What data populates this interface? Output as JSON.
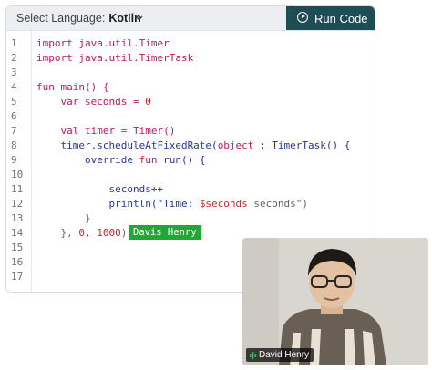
{
  "toolbar": {
    "select_label": "Select Language:",
    "language": "Kotlin",
    "run_label": "Run Code"
  },
  "gutter": [
    "1",
    "2",
    "3",
    "4",
    "5",
    "6",
    "7",
    "8",
    "9",
    "10",
    "11",
    "12",
    "13",
    "14",
    "15",
    "16",
    "17"
  ],
  "code": {
    "l1": [
      "import java.util.Timer"
    ],
    "l2": [
      "import java.util.TimerTask"
    ],
    "l4a": "fun",
    "l4b": " main() {",
    "l5a": "    var",
    "l5b": " seconds = ",
    "l5c": "0",
    "l7a": "    val",
    "l7b": " timer = Timer()",
    "l8a": "    timer.scheduleAtFixedRate(",
    "l8b": "object",
    "l8c": " : TimerTask() {",
    "l9a": "        override",
    "l9b": " fun",
    "l9c": " run() {",
    "l11": "            seconds++",
    "l12a": "            println(\"Time: ",
    "l12b": "$seconds",
    "l12c": " seconds\")",
    "l13": "        }",
    "l14a": "    }, ",
    "l14b": "0",
    "l14c": ", ",
    "l14d": "1000",
    "l14e": ")"
  },
  "cursor": {
    "user": "Davis Henry"
  },
  "video": {
    "participant": "David Henry"
  },
  "colors": {
    "run_bg": "#1f4d55",
    "cursor": "#22a63a",
    "keyword": "#c2185b",
    "number": "#c62828"
  }
}
